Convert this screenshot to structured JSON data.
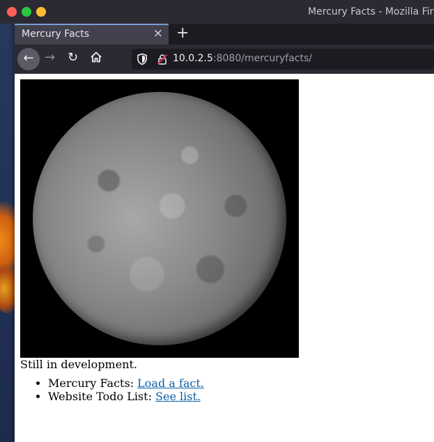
{
  "window": {
    "title": "Mercury Facts - Mozilla Fire"
  },
  "tab": {
    "title": "Mercury Facts",
    "close_icon": "×",
    "new_tab_icon": "+"
  },
  "nav": {
    "back_icon": "←",
    "forward_icon": "→",
    "reload_icon": "↻",
    "url_host": "10.0.2.5",
    "url_rest": ":8080/mercuryfacts/"
  },
  "page": {
    "image_alt": "Mercury",
    "status": "Still in development.",
    "links": [
      {
        "prefix": "Mercury Facts: ",
        "link": "Load a fact."
      },
      {
        "prefix": "Website Todo List: ",
        "link": "See list."
      }
    ]
  },
  "colors": {
    "link": "#0b5fa5",
    "tab_accent": "#7b9ed6",
    "chrome_dark": "#2b2a33"
  }
}
